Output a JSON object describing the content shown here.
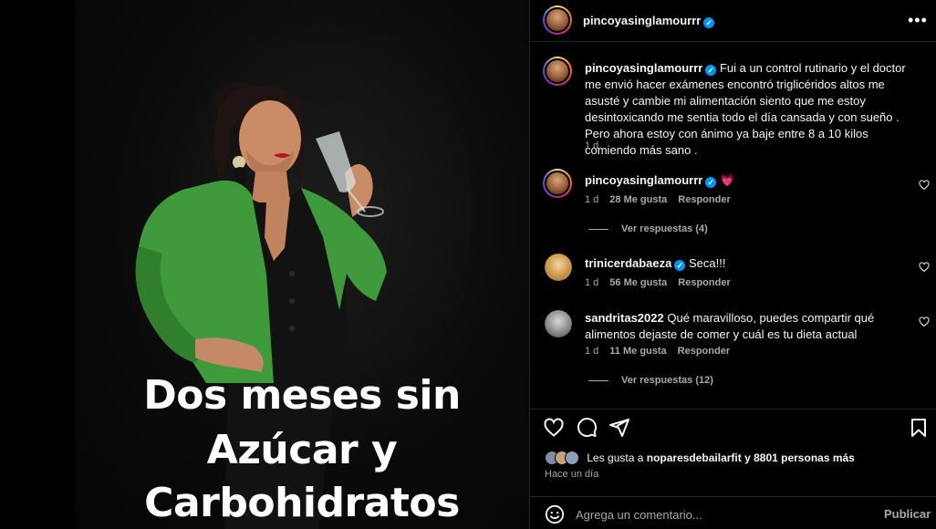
{
  "post": {
    "image_overlay": [
      "Dos meses sin",
      "Azúcar y",
      "Carbohidratos"
    ]
  },
  "header": {
    "username": "pincoyasinglamourrr",
    "more_icon": "more-horizontal-icon"
  },
  "caption": {
    "username": "pincoyasinglamourrr",
    "text": "Fui a un control rutinario y el doctor me envió hacer exámenes encontró triglicéridos altos me asusté y cambie mi alimentación siento que me estoy desintoxicando me sentia todo el día cansada y con sueño . Pero ahora estoy con ánimo ya baje entre 8 a 10 kilos comiendo más sano .",
    "time": "1 d"
  },
  "comments": [
    {
      "username": "pincoyasinglamourrr",
      "verified": true,
      "text": "💗",
      "time": "1 d",
      "likes": "28 Me gusta",
      "reply": "Responder",
      "view_replies": "Ver respuestas (4)"
    },
    {
      "username": "trinicerdabaeza",
      "verified": true,
      "text": "Seca!!!",
      "time": "1 d",
      "likes": "56 Me gusta",
      "reply": "Responder"
    },
    {
      "username": "sandritas2022",
      "verified": false,
      "text": "Qué maravilloso, puedes compartir qué alimentos dejaste de comer y cuál es tu dieta actual",
      "time": "1 d",
      "likes": "11 Me gusta",
      "reply": "Responder",
      "view_replies": "Ver respuestas (12)"
    }
  ],
  "likes": {
    "prefix": "Les gusta a ",
    "user": "noparesdebailarfit",
    "suffix": " y 8801 personas más"
  },
  "time_ago": "Hace un día",
  "add_comment": {
    "placeholder": "Agrega un comentario...",
    "publish_label": "Publicar"
  },
  "colors": {
    "background": "#000000",
    "text": "#f5f5f5",
    "muted": "#a8a8a8",
    "verified": "#0095f6",
    "heart": "#ff3040"
  }
}
